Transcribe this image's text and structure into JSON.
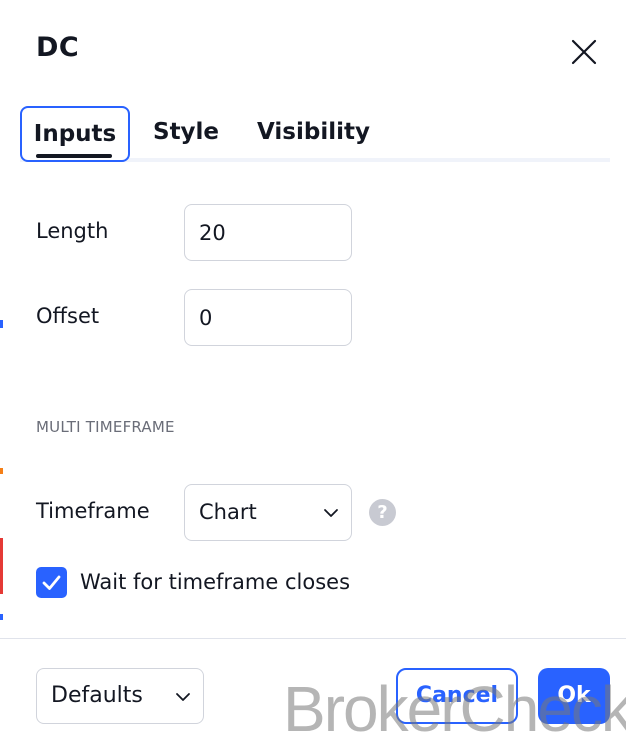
{
  "dialog": {
    "title": "DC"
  },
  "tabs": [
    {
      "label": "Inputs",
      "active": true
    },
    {
      "label": "Style",
      "active": false
    },
    {
      "label": "Visibility",
      "active": false
    }
  ],
  "inputs": {
    "length": {
      "label": "Length",
      "value": "20"
    },
    "offset": {
      "label": "Offset",
      "value": "0"
    }
  },
  "multi_timeframe": {
    "heading": "MULTI TIMEFRAME",
    "timeframe": {
      "label": "Timeframe",
      "selected": "Chart"
    },
    "wait_for_close": {
      "label": "Wait for timeframe closes",
      "checked": true
    }
  },
  "footer": {
    "defaults_label": "Defaults",
    "cancel_label": "Cancel",
    "ok_label": "Ok"
  },
  "icons": {
    "close": "close-icon",
    "chevron": "chevron-down-icon",
    "help": "question-mark-icon",
    "check": "checkmark-icon"
  },
  "colors": {
    "accent": "#2962ff",
    "text": "#131722",
    "muted": "#6a6d78",
    "border": "#d1d4dc",
    "help_icon": "#c8cad2"
  },
  "watermark": "BrokerCheck"
}
